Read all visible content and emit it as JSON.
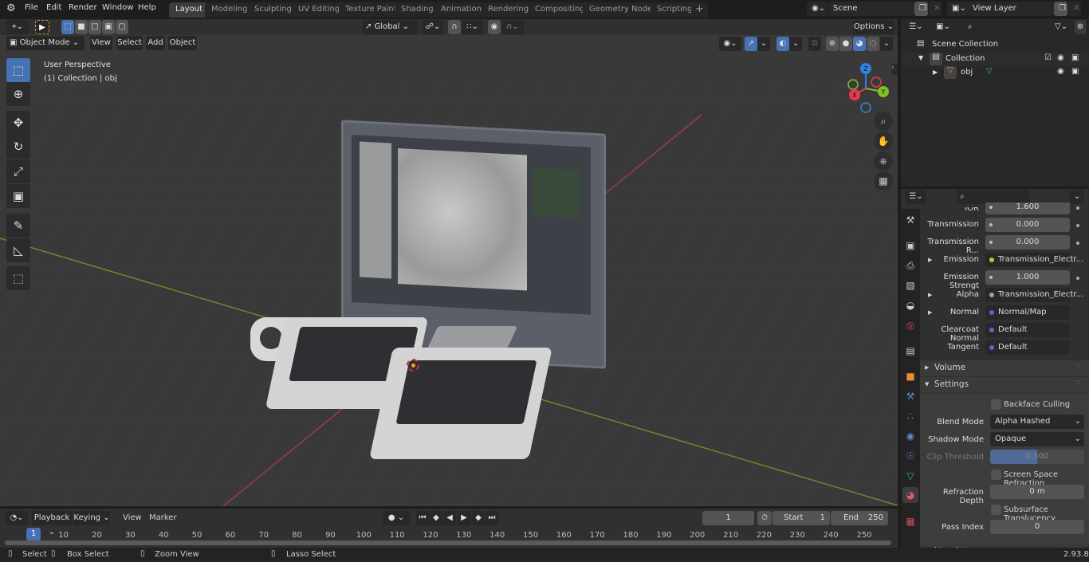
{
  "menu": [
    "File",
    "Edit",
    "Render",
    "Window",
    "Help"
  ],
  "workspaces": [
    "Layout",
    "Modeling",
    "Sculpting",
    "UV Editing",
    "Texture Paint",
    "Shading",
    "Animation",
    "Rendering",
    "Compositing",
    "Geometry Nodes",
    "Scripting"
  ],
  "active_workspace": "Layout",
  "scene": {
    "label": "Scene"
  },
  "view_layer": {
    "label": "View Layer"
  },
  "viewport_header": {
    "transform_orientation": "Global",
    "options_label": "Options",
    "mode": "Object Mode",
    "menus": [
      "View",
      "Select",
      "Add",
      "Object"
    ]
  },
  "viewport": {
    "view_name": "User Perspective",
    "collection_info": "(1) Collection | obj",
    "gizmo_axes": {
      "x": "X",
      "y": "Y",
      "z": "Z"
    },
    "axis_colors": {
      "x": "#e8394f",
      "y": "#7fbf23",
      "z": "#2f84e3"
    }
  },
  "toolbar": [
    "select-box",
    "cursor",
    "move",
    "rotate",
    "scale",
    "transform",
    "annotate",
    "measure",
    "add-cube"
  ],
  "outliner": {
    "rows": [
      {
        "label": "Scene Collection"
      },
      {
        "label": "Collection"
      },
      {
        "label": "obj"
      }
    ]
  },
  "properties": {
    "rows": [
      {
        "label": "IOR",
        "value": "1.600",
        "type": "slider"
      },
      {
        "label": "Transmission",
        "value": "0.000",
        "type": "slider"
      },
      {
        "label": "Transmission R...",
        "value": "0.000",
        "type": "slider"
      },
      {
        "label": "Emission",
        "value": "Transmission_Electr...",
        "type": "link",
        "dot": "#c7c729",
        "expand": true
      },
      {
        "label": "Emission Strengt",
        "value": "1.000",
        "type": "slider"
      },
      {
        "label": "Alpha",
        "value": "Transmission_Electr...",
        "type": "link",
        "dot": "#a0a0a0",
        "expand": true
      },
      {
        "label": "Normal",
        "value": "Normal/Map",
        "type": "link",
        "dot": "#6363c7",
        "expand": true
      },
      {
        "label": "Clearcoat Normal",
        "value": "Default",
        "type": "link",
        "dot": "#6363c7"
      },
      {
        "label": "Tangent",
        "value": "Default",
        "type": "link",
        "dot": "#6363c7"
      }
    ],
    "panels": {
      "volume": "Volume",
      "settings": "Settings",
      "line_art": "Line Art"
    },
    "settings": {
      "backface_culling": "Backface Culling",
      "blend_mode_label": "Blend Mode",
      "blend_mode": "Alpha Hashed",
      "shadow_mode_label": "Shadow Mode",
      "shadow_mode": "Opaque",
      "clip_threshold_label": "Clip Threshold",
      "clip_threshold": "0.500",
      "clip_threshold_fraction": 0.5,
      "ssr": "Screen Space Refraction",
      "refraction_depth_label": "Refraction Depth",
      "refraction_depth": "0 m",
      "subsurface": "Subsurface Translucency",
      "pass_index_label": "Pass Index",
      "pass_index": "0"
    }
  },
  "timeline": {
    "menus": [
      "Playback",
      "Keying",
      "View",
      "Marker"
    ],
    "current_frame": "1",
    "start_label": "Start",
    "start": "1",
    "end_label": "End",
    "end": "250",
    "ticks": [
      "10",
      "20",
      "30",
      "40",
      "50",
      "60",
      "70",
      "80",
      "90",
      "100",
      "110",
      "120",
      "130",
      "140",
      "150",
      "160",
      "170",
      "180",
      "190",
      "200",
      "210",
      "220",
      "230",
      "240",
      "250"
    ]
  },
  "statusbar": {
    "select": "Select",
    "box_select": "Box Select",
    "zoom_view": "Zoom View",
    "lasso_select": "Lasso Select",
    "version": "2.93.8"
  }
}
